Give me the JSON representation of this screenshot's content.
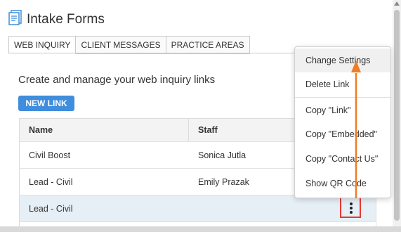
{
  "header": {
    "title": "Intake Forms",
    "icon": "form-document-icon"
  },
  "tabs": [
    {
      "label": "WEB INQUIRY",
      "active": true
    },
    {
      "label": "CLIENT MESSAGES",
      "active": false
    },
    {
      "label": "PRACTICE AREAS",
      "active": false
    }
  ],
  "main": {
    "subtitle": "Create and manage your web inquiry links",
    "new_link_label": "NEW LINK"
  },
  "table": {
    "columns": [
      "Name",
      "Staff"
    ],
    "rows": [
      {
        "name": "Civil Boost",
        "staff": "Sonica Jutla"
      },
      {
        "name": "Lead - Civil",
        "staff": "Emily Prazak"
      },
      {
        "name": "Lead - Civil",
        "staff": ""
      }
    ]
  },
  "context_menu": {
    "items": [
      "Change Settings",
      "Delete Link",
      "Copy \"Link\"",
      "Copy \"Embedded\"",
      "Copy \"Contact Us\"",
      "Show QR Code"
    ]
  },
  "colors": {
    "accent": "#3f8ddc",
    "highlight_box": "#e53935",
    "annotation_arrow": "#f07c23",
    "selected_row": "#e6eef6"
  }
}
